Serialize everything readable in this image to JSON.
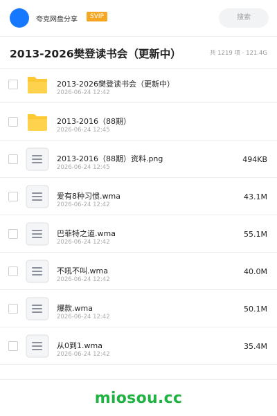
{
  "header": {
    "share_name": "夸克网盘分享",
    "badge": "SVIP",
    "search_label": "搜索",
    "avatar_color": "#1677ff"
  },
  "folder": {
    "title": "2013-2026樊登读书会（更新中）",
    "summary": "共 1219 项 · 121.4G"
  },
  "files": [
    {
      "name": "2013-2026樊登读书会（更新中）",
      "date": "2026-06-24 12:42",
      "size": "",
      "icon": "folder-icon"
    },
    {
      "name": "2013-2016（88期）",
      "date": "2026-06-24 12:45",
      "size": "",
      "icon": "folder-icon"
    },
    {
      "name": "2013-2016（88期）资料.png",
      "date": "2026-06-24 12:45",
      "size": "494KB",
      "icon": "file-icon"
    },
    {
      "name": "爱有8种习惯.wma",
      "date": "2026-06-24 12:42",
      "size": "43.1M",
      "icon": "file-icon"
    },
    {
      "name": "巴菲特之道.wma",
      "date": "2026-06-24 12:42",
      "size": "55.1M",
      "icon": "file-icon"
    },
    {
      "name": "不吼不叫.wma",
      "date": "2026-06-24 12:42",
      "size": "40.0M",
      "icon": "file-icon"
    },
    {
      "name": "爆款.wma",
      "date": "2026-06-24 12:42",
      "size": "50.1M",
      "icon": "file-icon"
    },
    {
      "name": "从0到1.wma",
      "date": "2026-06-24 12:42",
      "size": "35.4M",
      "icon": "file-icon"
    }
  ],
  "footer": {
    "watermark": "miosou.cc",
    "watermark_color": "#1fb141"
  },
  "colors": {
    "folder_yellow": "#ffc933",
    "badge_orange": "#f5a623"
  }
}
